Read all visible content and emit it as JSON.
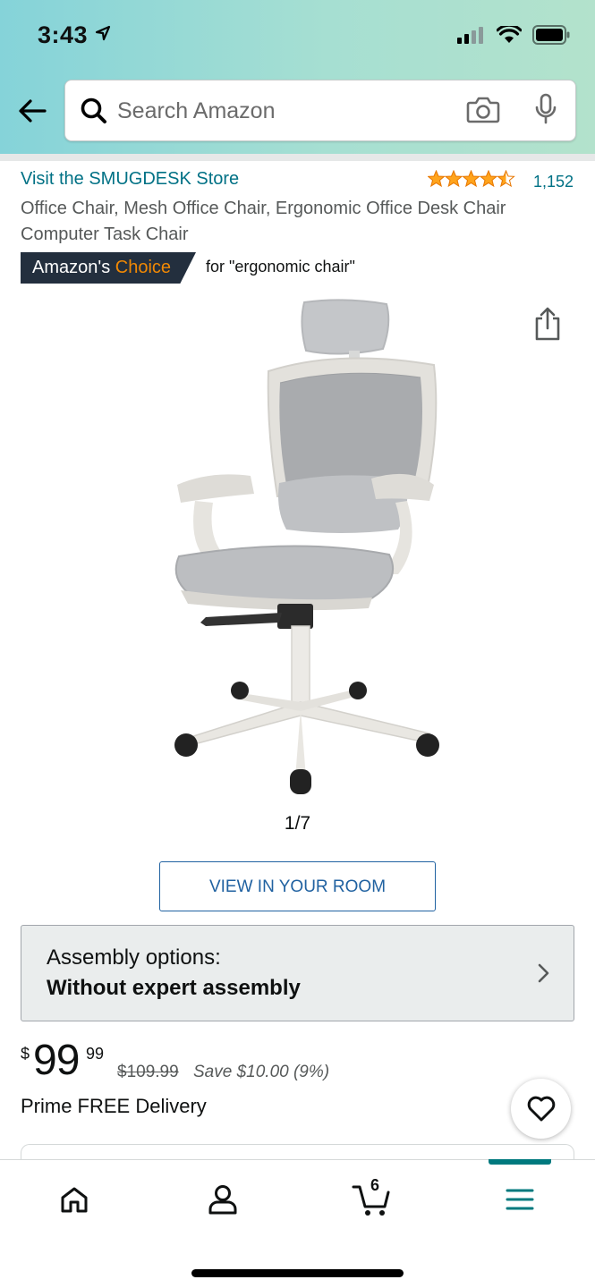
{
  "status_bar": {
    "time": "3:43"
  },
  "search": {
    "placeholder": "Search Amazon"
  },
  "product": {
    "store_link": "Visit the SMUGDESK Store",
    "rating_stars": 4.5,
    "rating_count": "1,152",
    "title": "Office Chair, Mesh Office Chair, Ergonomic Office Desk Chair Computer Task Chair",
    "badge": {
      "prefix": "Amazon's",
      "highlight": "Choice",
      "for_text": "for \"ergonomic chair\""
    },
    "image_counter": "1/7",
    "view_in_room_label": "VIEW IN YOUR ROOM"
  },
  "assembly": {
    "label": "Assembly options:",
    "value": "Without expert assembly"
  },
  "price": {
    "symbol": "$",
    "whole": "99",
    "fraction": "99",
    "list_price": "$109.99",
    "savings": "Save $10.00 (9%)",
    "delivery": "Prime FREE Delivery"
  },
  "bottom_nav": {
    "items": [
      {
        "icon": "home-icon"
      },
      {
        "icon": "account-icon"
      },
      {
        "icon": "cart-icon",
        "badge": "6"
      },
      {
        "icon": "menu-icon",
        "active": true
      }
    ]
  },
  "colors": {
    "link": "#007185",
    "badge_dark": "#232f3e",
    "badge_orange": "#f08804",
    "star": "#e77600",
    "button_blue": "#2162a1",
    "nav_active": "#00797e"
  }
}
